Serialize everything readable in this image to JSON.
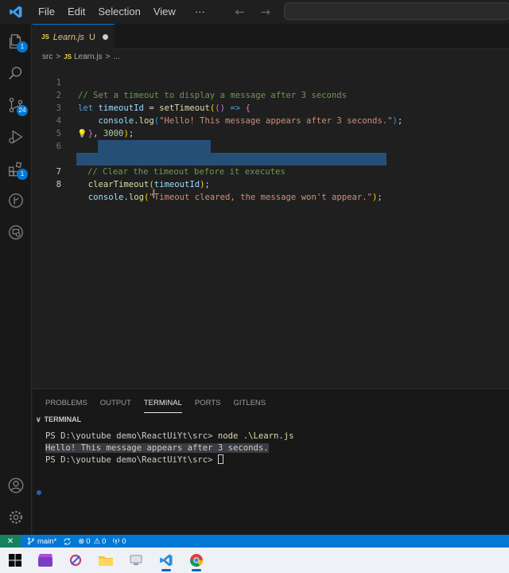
{
  "titlebar": {
    "menu": [
      "File",
      "Edit",
      "Selection",
      "View",
      "···"
    ]
  },
  "activity_badges": {
    "explorer": "1",
    "source_control": "24",
    "extensions": "1"
  },
  "tab": {
    "file_badge": "JS",
    "name": "Learn.js",
    "status": "U"
  },
  "breadcrumb": {
    "folder": "src",
    "sep1": ">",
    "file_badge": "JS",
    "file": "Learn.js",
    "sep2": ">",
    "more": "..."
  },
  "editor": {
    "line_numbers": [
      "1",
      "2",
      "3",
      "4",
      "5",
      "6",
      "7",
      "8"
    ]
  },
  "panel": {
    "tabs": [
      "PROBLEMS",
      "OUTPUT",
      "TERMINAL",
      "PORTS",
      "GITLENS"
    ],
    "section_title": "TERMINAL",
    "terminal_lines": [
      "PS D:\\youtube demo\\ReactUiYt\\src> ",
      "node .\\Learn.js",
      "Hello! This message appears after 3 seconds.",
      "PS D:\\youtube demo\\ReactUiYt\\src> "
    ]
  },
  "statusbar": {
    "branch": "main*",
    "errors": "0",
    "warnings": "0",
    "ports": "0"
  },
  "colors": {
    "accent": "#0078d4",
    "selection": "#264f78",
    "remote": "#16825d"
  }
}
